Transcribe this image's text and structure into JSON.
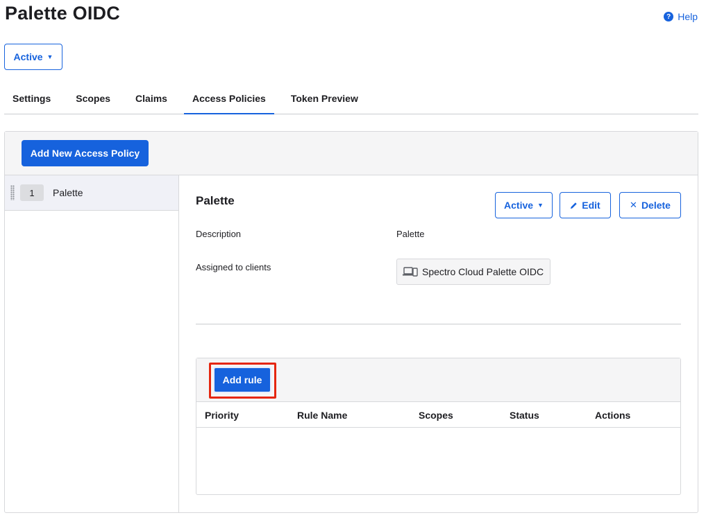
{
  "header": {
    "title": "Palette OIDC",
    "help_label": "Help",
    "status_label": "Active"
  },
  "tabs": [
    {
      "label": "Settings",
      "active": false
    },
    {
      "label": "Scopes",
      "active": false
    },
    {
      "label": "Claims",
      "active": false
    },
    {
      "label": "Access Policies",
      "active": true
    },
    {
      "label": "Token Preview",
      "active": false
    }
  ],
  "policies_panel": {
    "add_policy_label": "Add New Access Policy",
    "policies": [
      {
        "priority": "1",
        "name": "Palette"
      }
    ]
  },
  "policy_detail": {
    "title": "Palette",
    "status_label": "Active",
    "edit_label": "Edit",
    "delete_label": "Delete",
    "description_label": "Description",
    "description_value": "Palette",
    "assigned_label": "Assigned to clients",
    "assigned_client": "Spectro Cloud Palette OIDC"
  },
  "rules": {
    "add_rule_label": "Add rule",
    "columns": [
      "Priority",
      "Rule Name",
      "Scopes",
      "Status",
      "Actions"
    ],
    "rows": []
  },
  "colors": {
    "accent": "#1662dd",
    "highlight": "#e5260f"
  }
}
